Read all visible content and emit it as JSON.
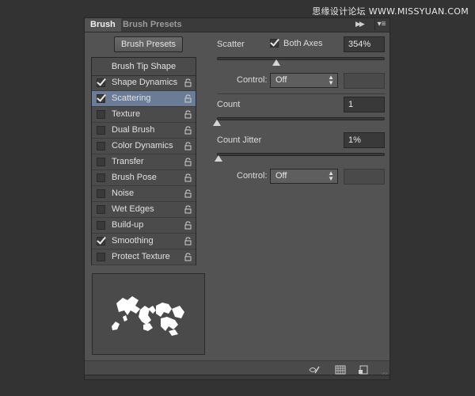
{
  "watermark": "思缘设计论坛 WWW.MISSYUAN.COM",
  "tabs": [
    {
      "label": "Brush",
      "active": true
    },
    {
      "label": "Brush Presets",
      "active": false
    }
  ],
  "brush_presets_button": "Brush Presets",
  "tip_shape_header": "Brush Tip Shape",
  "items": [
    {
      "label": "Shape Dynamics",
      "checked": true,
      "selected": false
    },
    {
      "label": "Scattering",
      "checked": true,
      "selected": true
    },
    {
      "label": "Texture",
      "checked": false,
      "selected": false
    },
    {
      "label": "Dual Brush",
      "checked": false,
      "selected": false
    },
    {
      "label": "Color Dynamics",
      "checked": false,
      "selected": false
    },
    {
      "label": "Transfer",
      "checked": false,
      "selected": false
    },
    {
      "label": "Brush Pose",
      "checked": false,
      "selected": false
    },
    {
      "label": "Noise",
      "checked": false,
      "selected": false
    },
    {
      "label": "Wet Edges",
      "checked": false,
      "selected": false
    },
    {
      "label": "Build-up",
      "checked": false,
      "selected": false
    },
    {
      "label": "Smoothing",
      "checked": true,
      "selected": false
    },
    {
      "label": "Protect Texture",
      "checked": false,
      "selected": false
    }
  ],
  "scatter": {
    "label": "Scatter",
    "both_axes_label": "Both Axes",
    "both_axes_checked": true,
    "value": "354%",
    "slider_fraction": 0.354,
    "control_label": "Control:",
    "control_value": "Off"
  },
  "count": {
    "label": "Count",
    "value": "1",
    "slider_fraction": 0.0
  },
  "count_jitter": {
    "label": "Count Jitter",
    "value": "1%",
    "slider_fraction": 0.01,
    "control_label": "Control:",
    "control_value": "Off"
  },
  "colors": {
    "panel_bg": "#535353",
    "selection": "#6b7c97",
    "app_bg": "#333333"
  },
  "footer_icons": [
    "eye-brush-icon",
    "grid-icon",
    "new-preset-icon"
  ]
}
